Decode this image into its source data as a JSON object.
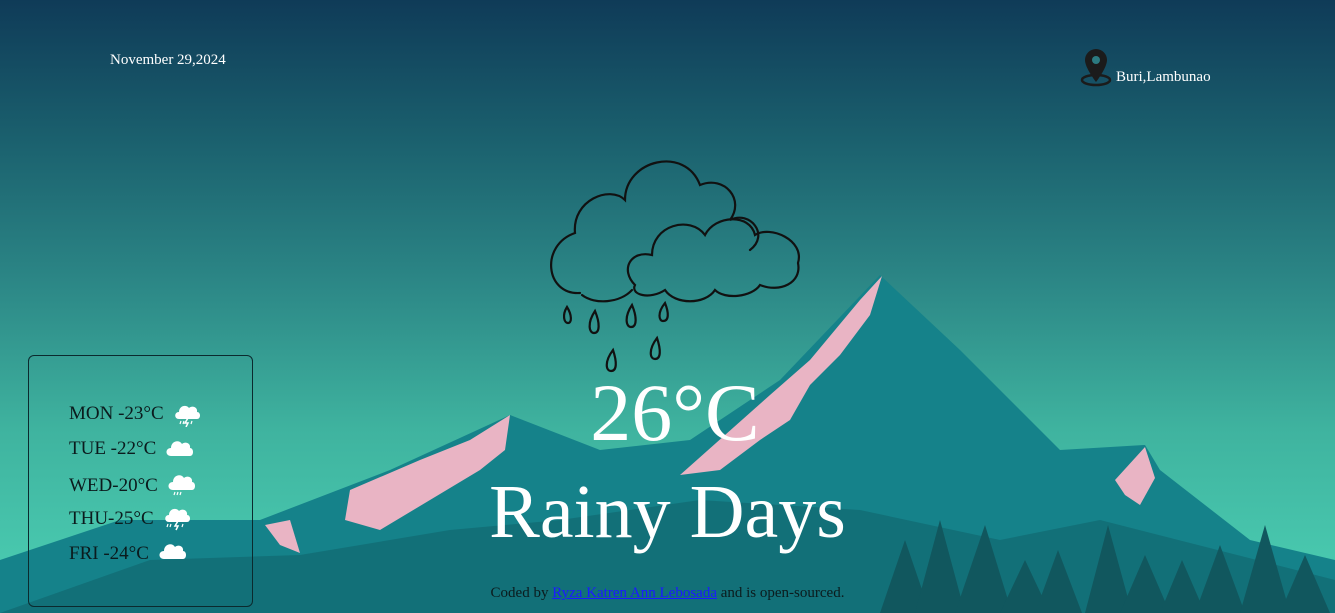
{
  "header": {
    "date": "November 29,2024",
    "location": "Buri,Lambunao"
  },
  "current": {
    "temperature": "26°C",
    "condition": "Rainy Days",
    "icon": "rain-cloud-icon"
  },
  "forecast": [
    {
      "label": "MON -23°C",
      "icon": "thunder-rain-icon"
    },
    {
      "label": "TUE -22°C",
      "icon": "cloud-icon"
    },
    {
      "label": "WED-20°C",
      "icon": "rain-cloud-icon"
    },
    {
      "label": "THU-25°C",
      "icon": "thunder-rain-icon"
    },
    {
      "label": "FRI -24°C",
      "icon": "cloud-icon"
    }
  ],
  "footer": {
    "prefix": "Coded by",
    "author": "Ryza Katren Ann Lebosada",
    "suffix": "and is open-sourced."
  },
  "colors": {
    "sky_top": "#0f3b58",
    "sky_bottom": "#4cd0b4",
    "mountain": "#14797f",
    "snow": "#e9b4c4",
    "trees": "#11575e"
  }
}
